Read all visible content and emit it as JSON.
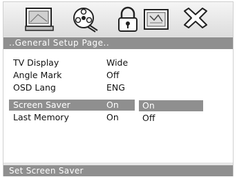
{
  "icons": [
    "monitor-icon",
    "film-reel-icon",
    "padlock-icon",
    "preferences-grid-icon",
    "close-x-icon"
  ],
  "title": "..General Setup Page..",
  "settings": [
    {
      "label": "TV Display",
      "value": "Wide"
    },
    {
      "label": "Angle Mark",
      "value": "Off"
    },
    {
      "label": "OSD Lang",
      "value": "ENG"
    },
    {
      "label": "Screen Saver",
      "value": "On"
    },
    {
      "label": "Last Memory",
      "value": "On"
    }
  ],
  "options": [
    {
      "label": "On",
      "selected": true
    },
    {
      "label": "Off",
      "selected": false
    }
  ],
  "status": "Set Screen Saver",
  "colors": {
    "highlight": "#8f8f8f",
    "panel": "#ffffff",
    "chrome": "#e6e6e6"
  }
}
